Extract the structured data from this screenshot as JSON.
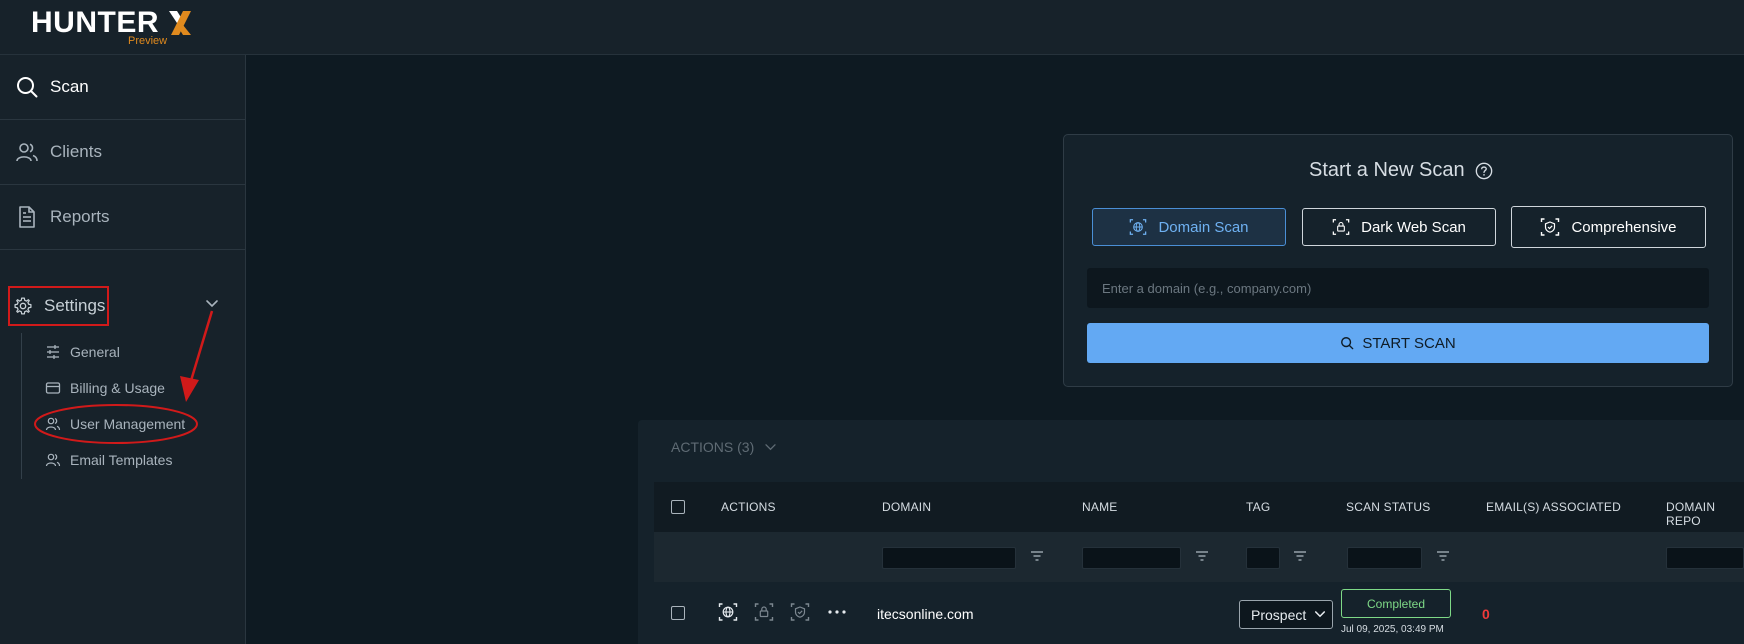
{
  "brand": {
    "name": "HUNTER",
    "badge": "Preview",
    "accent": "#e08a1e"
  },
  "sidebar": {
    "items": [
      {
        "label": "Scan",
        "icon": "search-icon"
      },
      {
        "label": "Clients",
        "icon": "users-icon"
      },
      {
        "label": "Reports",
        "icon": "document-icon"
      },
      {
        "label": "Settings",
        "icon": "gear-icon"
      }
    ],
    "settings_sub": [
      {
        "label": "General",
        "icon": "sliders-icon"
      },
      {
        "label": "Billing & Usage",
        "icon": "credit-card-icon"
      },
      {
        "label": "User Management",
        "icon": "users-icon"
      },
      {
        "label": "Email Templates",
        "icon": "users-icon"
      }
    ]
  },
  "scan_card": {
    "title": "Start a New Scan",
    "buttons": [
      {
        "label": "Domain Scan",
        "icon": "globe-scan-icon",
        "active": true
      },
      {
        "label": "Dark Web Scan",
        "icon": "lock-scan-icon",
        "active": false
      },
      {
        "label": "Comprehensive",
        "icon": "shield-scan-icon",
        "active": false
      }
    ],
    "input_placeholder": "Enter a domain (e.g., company.com)",
    "input_value": "",
    "start_label": "START SCAN"
  },
  "table": {
    "actions_label": "ACTIONS (3)",
    "columns": [
      "ACTIONS",
      "DOMAIN",
      "NAME",
      "TAG",
      "SCAN STATUS",
      "EMAIL(S) ASSOCIATED",
      "DOMAIN REPO"
    ],
    "rows": [
      {
        "domain": "itecsonline.com",
        "name": "",
        "tag": "Prospect",
        "status": "Completed",
        "status_time": "Jul 09, 2025, 03:49 PM",
        "emails": "0"
      }
    ]
  },
  "colors": {
    "background": "#0e1a22",
    "panel": "#17222a",
    "primary": "#63a9f3",
    "success": "#7ed987",
    "danger": "#f03a3a",
    "annotation": "#d11a1a"
  }
}
